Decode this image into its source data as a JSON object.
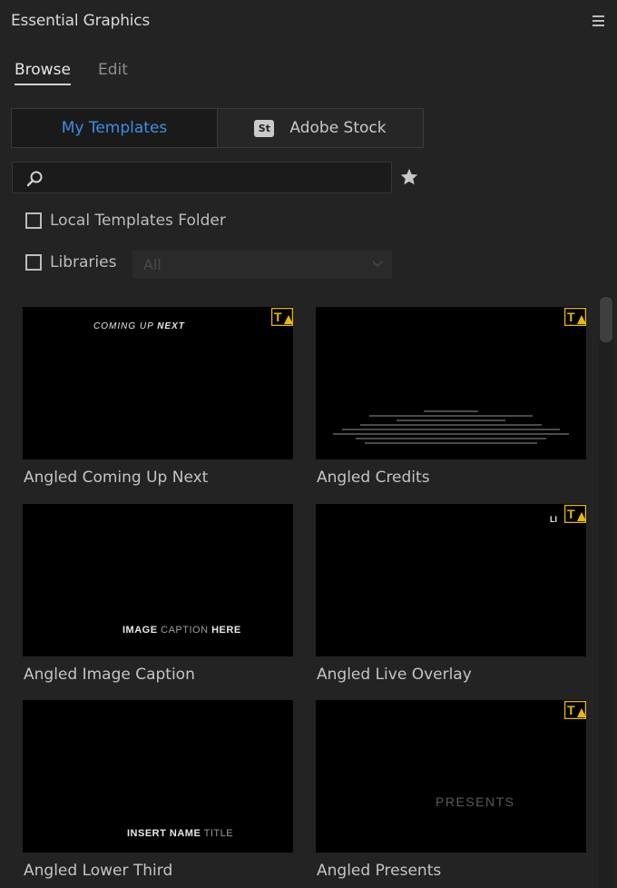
{
  "panel": {
    "title": "Essential Graphics",
    "menu_icon": "hamburger-menu-icon"
  },
  "tabs": [
    {
      "label": "Browse",
      "active": true
    },
    {
      "label": "Edit",
      "active": false
    }
  ],
  "source_switch": {
    "my_templates": "My Templates",
    "adobe_stock": "Adobe Stock",
    "adobe_stock_badge": "St",
    "active": "my_templates",
    "active_color": "#3c8ee6"
  },
  "search": {
    "placeholder": "",
    "value": "",
    "icon": "search-icon",
    "favorites_icon": "star-icon"
  },
  "filters": {
    "local_templates_folder": {
      "label": "Local Templates Folder",
      "checked": false
    },
    "libraries": {
      "label": "Libraries",
      "checked": false
    },
    "libraries_select": {
      "value": "All",
      "disabled": true
    }
  },
  "templates": [
    {
      "name": "Angled Coming Up Next",
      "preview_text_a": "COMING UP",
      "preview_text_b": "NEXT",
      "has_warning": true
    },
    {
      "name": "Angled Credits",
      "has_warning": true
    },
    {
      "name": "Angled Image Caption",
      "preview_text_a": "IMAGE",
      "preview_text_b": "CAPTION",
      "preview_text_c": "HERE",
      "has_warning": false
    },
    {
      "name": "Angled Live Overlay",
      "preview_text_a": "LI",
      "has_warning": true
    },
    {
      "name": "Angled Lower Third",
      "preview_text_a": "INSERT NAME",
      "preview_text_b": "TITLE",
      "has_warning": false
    },
    {
      "name": "Angled Presents",
      "preview_text_a": "PRESENTS",
      "has_warning": true
    }
  ],
  "colors": {
    "panel_bg": "#232323",
    "warning_badge": "#e8b90c",
    "accent": "#3c8ee6"
  }
}
